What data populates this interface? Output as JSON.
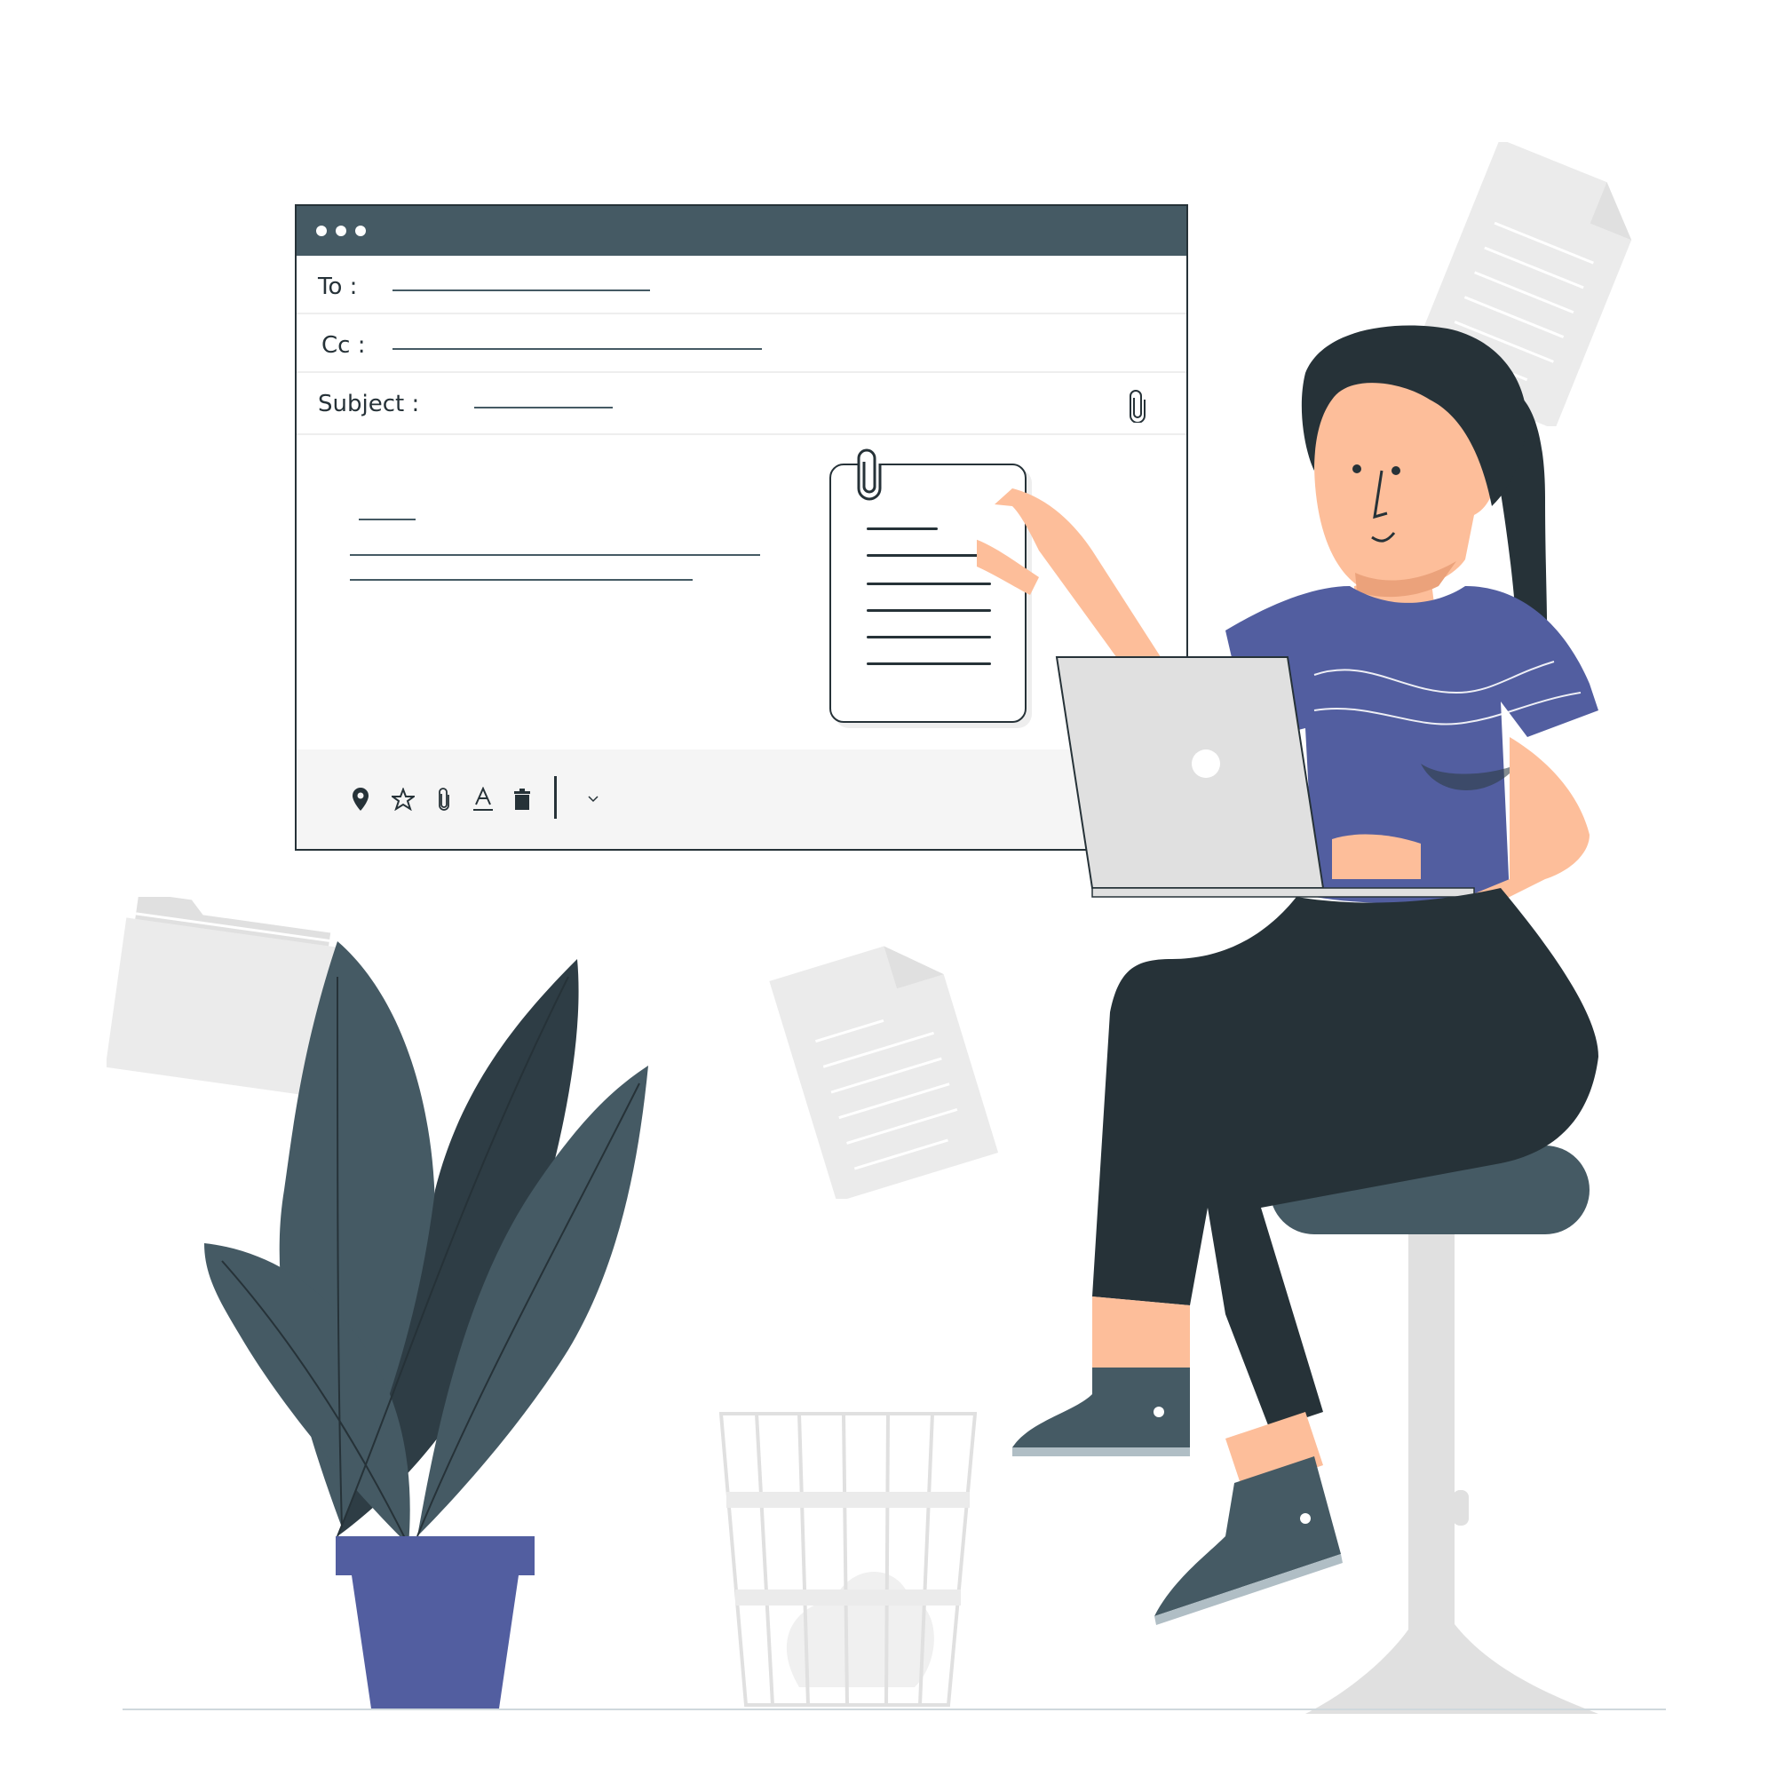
{
  "email": {
    "to_label": "To :",
    "cc_label": "Cc :",
    "subject_label": "Subject :"
  },
  "toolbar": {
    "icons": [
      "location-icon",
      "star-icon",
      "paperclip-icon",
      "text-format-icon",
      "delete-icon",
      "chevron-down-icon"
    ]
  },
  "colors": {
    "dark": "#263238",
    "slate": "#455a64",
    "purple": "#525ea0",
    "skin": "#fdbe9a",
    "light_gray": "#e0e0e0",
    "paper": "#ebebeb"
  }
}
